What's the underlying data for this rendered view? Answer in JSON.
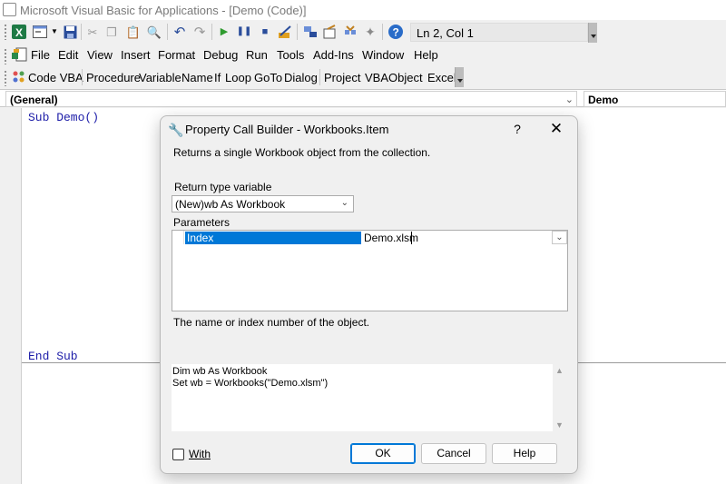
{
  "window": {
    "title": "Microsoft Visual Basic for Applications - [Demo (Code)]"
  },
  "toolbar_standard": {
    "position_readout": "Ln 2, Col 1",
    "icons": [
      "excel-icon",
      "insert-userform-icon",
      "save-icon",
      "cut-icon",
      "copy-icon",
      "paste-icon",
      "find-icon",
      "undo-icon",
      "redo-icon",
      "run-icon",
      "break-icon",
      "reset-icon",
      "design-mode-icon",
      "project-explorer-icon",
      "properties-icon",
      "object-browser-icon",
      "toolbox-icon",
      "help-icon"
    ]
  },
  "menubar": {
    "items": [
      "File",
      "Edit",
      "View",
      "Insert",
      "Format",
      "Debug",
      "Run",
      "Tools",
      "Add-Ins",
      "Window",
      "Help"
    ]
  },
  "addin_toolbar": {
    "items": [
      "Code VBA",
      "Procedure",
      "Variable",
      "Name",
      "If",
      "Loop",
      "GoTo",
      "Dialog",
      "Project",
      "VBA",
      "Object",
      "Excel"
    ]
  },
  "object_bar": {
    "object": "(General)",
    "procedure": "Demo"
  },
  "code": {
    "line1": "Sub Demo()",
    "line_end": "End Sub"
  },
  "dialog": {
    "title": "Property Call Builder - Workbooks.Item",
    "help": "?",
    "close": "✕",
    "description": "Returns a single Workbook object from the collection.",
    "return_label": "Return type variable",
    "return_value": "(New)wb As Workbook",
    "params_label": "Parameters",
    "params": [
      {
        "name": "Index",
        "value": "Demo.xlsm"
      }
    ],
    "hint": "The name or index number of the object.",
    "preview": {
      "line1": "Dim wb As Workbook",
      "line2": "Set wb = Workbooks(\"Demo.xlsm\")"
    },
    "with_label": "With",
    "ok_label": "OK",
    "cancel_label": "Cancel",
    "help_label": "Help"
  },
  "colors": {
    "selection": "#0078d7",
    "keyword": "#1c1ca8"
  }
}
